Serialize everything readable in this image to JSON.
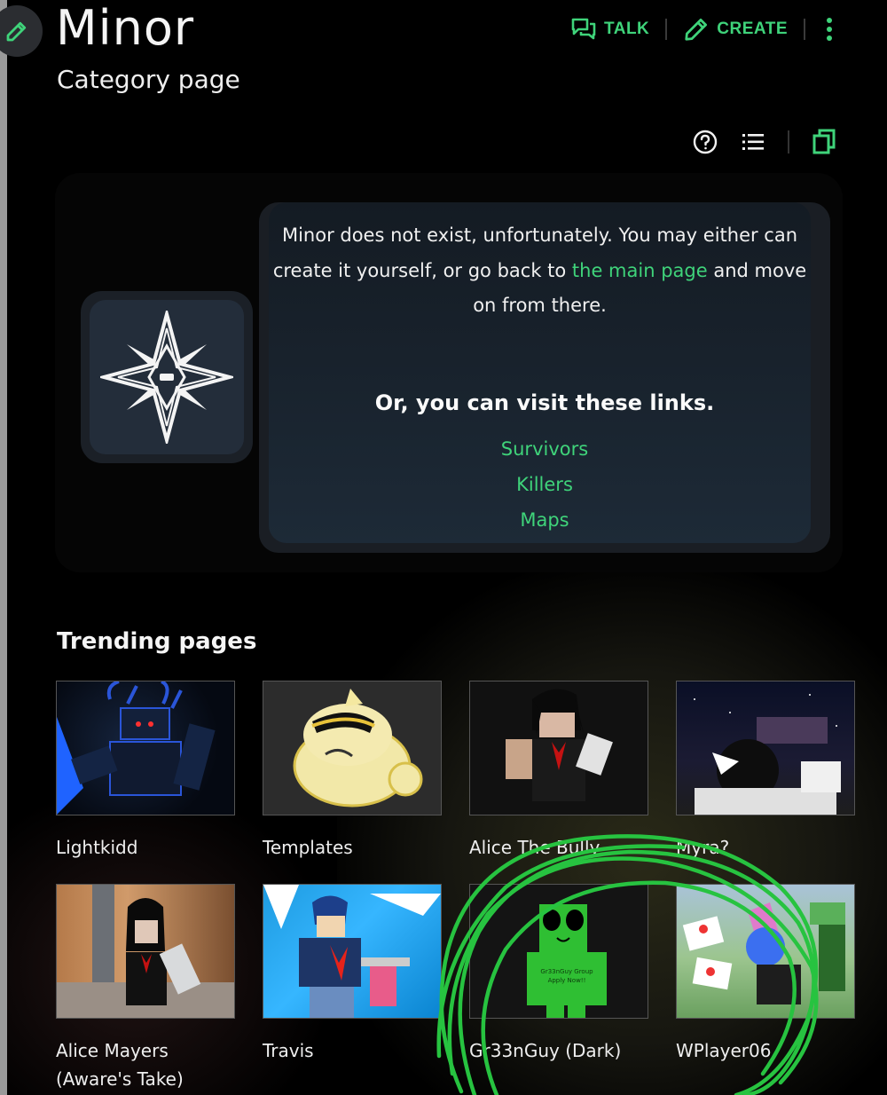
{
  "page": {
    "title": "Minor",
    "subtitle": "Category page"
  },
  "actions": {
    "talk_label": "TALK",
    "create_label": "CREATE"
  },
  "notice": {
    "line1": "Minor does not exist, unfortunately. You may either can",
    "line2_pre": "create it yourself, or go back to ",
    "line2_link": "the main page",
    "line2_post": " and move",
    "line3": "on from there.",
    "links_heading": "Or, you can visit these links.",
    "links": [
      "Survivors",
      "Killers",
      "Maps"
    ]
  },
  "trending": {
    "title": "Trending pages",
    "items": [
      {
        "label": "Lightkidd"
      },
      {
        "label": "Templates"
      },
      {
        "label": "Alice The Bully"
      },
      {
        "label": "Myra?"
      },
      {
        "label_line1": "Alice Mayers",
        "label_line2": "(Aware's Take)"
      },
      {
        "label": "Travis"
      },
      {
        "label": "Gr33nGuy (Dark)",
        "thumb_text1": "Gr33nGuy Group",
        "thumb_text2": "Apply Now!!"
      },
      {
        "label": "WPlayer06"
      }
    ]
  },
  "colors": {
    "accent": "#3fd37a",
    "background": "#000000",
    "card": "#1d2a37",
    "scribble": "#27c340"
  },
  "icons": {
    "edit": "pencil-icon",
    "talk": "talk-bubbles-icon",
    "create": "pencil-icon",
    "more": "kebab-icon",
    "help": "question-circle-icon",
    "toc": "list-icon",
    "pages": "copy-pages-icon",
    "logo": "four-point-star-emblem"
  }
}
